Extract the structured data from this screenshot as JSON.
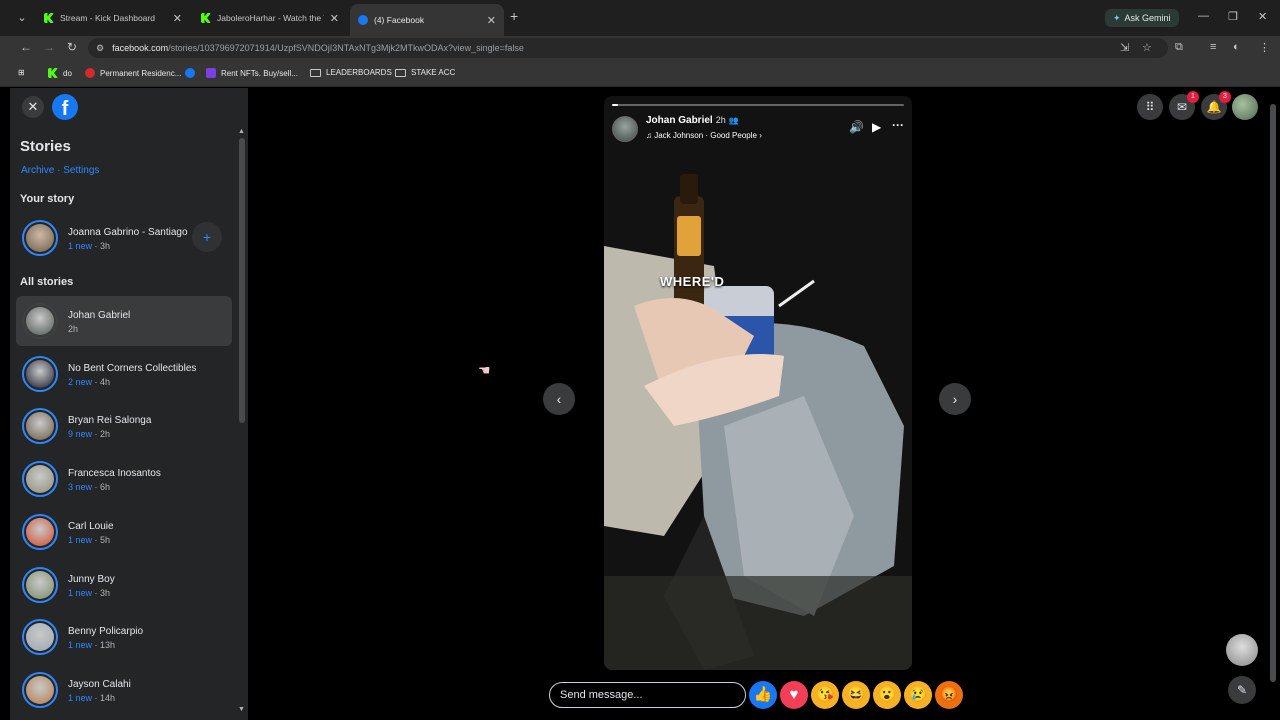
{
  "browser": {
    "tabs": [
      {
        "title": "Stream - Kick Dashboard",
        "icon": "kick-icon"
      },
      {
        "title": "JaboleroHarhar - Watch the VO",
        "icon": "kick-icon"
      },
      {
        "title": "(4) Facebook",
        "icon": "facebook-icon",
        "active": true
      }
    ],
    "gemini_label": "Ask Gemini",
    "url_host": "facebook.com",
    "url_path": "/stories/103796972071914/UzpfSVNDOjI3NTAxNTg3Mjk2MTkwODAx?view_single=false",
    "bookmarks": [
      {
        "label": "do",
        "icon": "kick-icon"
      },
      {
        "label": "Permanent Residenc...",
        "icon": "maple-icon"
      },
      {
        "label": "",
        "icon": "facebook-icon"
      },
      {
        "label": "Rent NFTs. Buy/sell...",
        "icon": "app-icon"
      },
      {
        "label": "LEADERBOARDS",
        "icon": "folder-icon"
      },
      {
        "label": "STAKE ACC",
        "icon": "folder-icon"
      }
    ]
  },
  "sidebar": {
    "title": "Stories",
    "archive_label": "Archive",
    "separator": " · ",
    "settings_label": "Settings",
    "your_story_heading": "Your story",
    "your_story": {
      "name": "Joanna Gabrino - Santiago",
      "new_label": "1 new",
      "time": "3h"
    },
    "all_stories_heading": "All stories",
    "stories": [
      {
        "name": "Johan Gabriel",
        "new_label": "",
        "time": "2h",
        "color": "#4e5a52"
      },
      {
        "name": "No Bent Corners Collectibles",
        "new_label": "2 new",
        "time": "4h",
        "color": "#1b1b2e"
      },
      {
        "name": "Bryan Rei Salonga",
        "new_label": "9 new",
        "time": "2h",
        "color": "#6b5b4a"
      },
      {
        "name": "Francesca Inosantos",
        "new_label": "3 new",
        "time": "6h",
        "color": "#8d8f7a"
      },
      {
        "name": "Carl Louie",
        "new_label": "1 new",
        "time": "5h",
        "color": "#d14a2c"
      },
      {
        "name": "Junny Boy",
        "new_label": "1 new",
        "time": "3h",
        "color": "#7a8b6a"
      },
      {
        "name": "Benny Policarpio",
        "new_label": "1 new",
        "time": "13h",
        "color": "#9aa7b0"
      },
      {
        "name": "Jayson Calahi",
        "new_label": "1 new",
        "time": "14h",
        "color": "#b57a4a"
      }
    ]
  },
  "story": {
    "author": "Johan Gabriel",
    "time": "2h",
    "music": "Jack Johnson · Good People",
    "overlay_text": "WHERE'D",
    "progress": 0.02
  },
  "reply": {
    "placeholder": "Send message..."
  },
  "reactions": [
    "like-icon",
    "heart-icon",
    "kiss-icon",
    "laugh-icon",
    "wow-icon",
    "sad-icon",
    "angry-icon"
  ],
  "notifications": {
    "messenger_count": "1",
    "bell_count": "3"
  }
}
